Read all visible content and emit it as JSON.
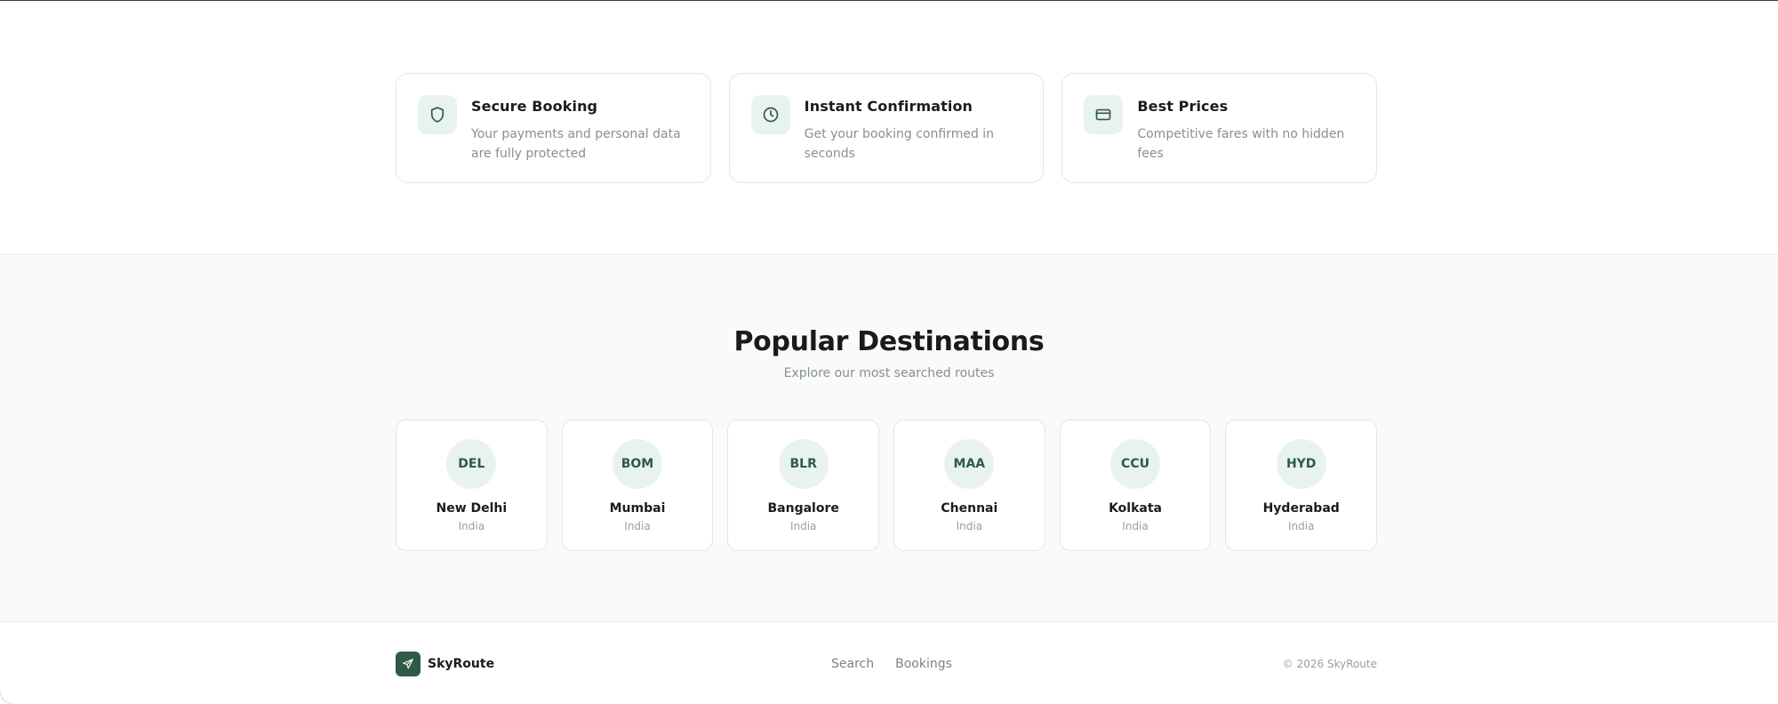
{
  "features": [
    {
      "icon": "shield-icon",
      "title": "Secure Booking",
      "description": "Your payments and personal data are fully protected"
    },
    {
      "icon": "clock-icon",
      "title": "Instant Confirmation",
      "description": "Get your booking confirmed in seconds"
    },
    {
      "icon": "credit-card-icon",
      "title": "Best Prices",
      "description": "Competitive fares with no hidden fees"
    }
  ],
  "destinations": {
    "title": "Popular Destinations",
    "subtitle": "Explore our most searched routes",
    "items": [
      {
        "code": "DEL",
        "city": "New Delhi",
        "country": "India"
      },
      {
        "code": "BOM",
        "city": "Mumbai",
        "country": "India"
      },
      {
        "code": "BLR",
        "city": "Bangalore",
        "country": "India"
      },
      {
        "code": "MAA",
        "city": "Chennai",
        "country": "India"
      },
      {
        "code": "CCU",
        "city": "Kolkata",
        "country": "India"
      },
      {
        "code": "HYD",
        "city": "Hyderabad",
        "country": "India"
      }
    ]
  },
  "footer": {
    "brand": "SkyRoute",
    "links": [
      "Search",
      "Bookings"
    ],
    "copyright": "© 2026 SkyRoute"
  },
  "colors": {
    "accent": "#2f5a47",
    "accent_soft": "#e9f3ee",
    "section_bg": "#f8fbf9"
  }
}
